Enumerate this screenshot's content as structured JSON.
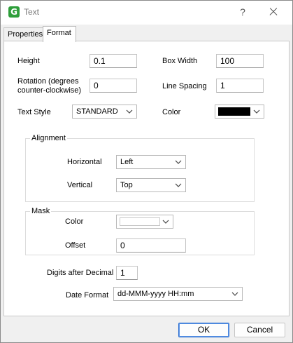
{
  "window": {
    "title": "Text",
    "help": "?"
  },
  "tabs": [
    {
      "label": "Properties",
      "active": false
    },
    {
      "label": "Format",
      "active": true
    }
  ],
  "format": {
    "height": {
      "label": "Height",
      "value": "0.1"
    },
    "box_width": {
      "label": "Box Width",
      "value": "100"
    },
    "rotation": {
      "label_line1": "Rotation (degrees",
      "label_line2": "counter-clockwise)",
      "value": "0"
    },
    "line_spacing": {
      "label": "Line Spacing",
      "value": "1"
    },
    "text_style": {
      "label": "Text Style",
      "value": "STANDARD"
    },
    "color": {
      "label": "Color",
      "value_hex": "#000000"
    },
    "alignment": {
      "group_label": "Alignment",
      "horizontal": {
        "label": "Horizontal",
        "value": "Left"
      },
      "vertical": {
        "label": "Vertical",
        "value": "Top"
      }
    },
    "mask": {
      "group_label": "Mask",
      "color": {
        "label": "Color",
        "value_hex": "#ffffff"
      },
      "offset": {
        "label": "Offset",
        "value": "0"
      }
    },
    "digits_after_decimal": {
      "label": "Digits after Decimal",
      "value": "1"
    },
    "date_format": {
      "label": "Date Format",
      "value": "dd-MMM-yyyy HH:mm"
    }
  },
  "buttons": {
    "ok": "OK",
    "cancel": "Cancel"
  },
  "icons": {
    "app": "app-logo-icon",
    "close": "close-icon",
    "dropdown": "chevron-down-icon"
  }
}
